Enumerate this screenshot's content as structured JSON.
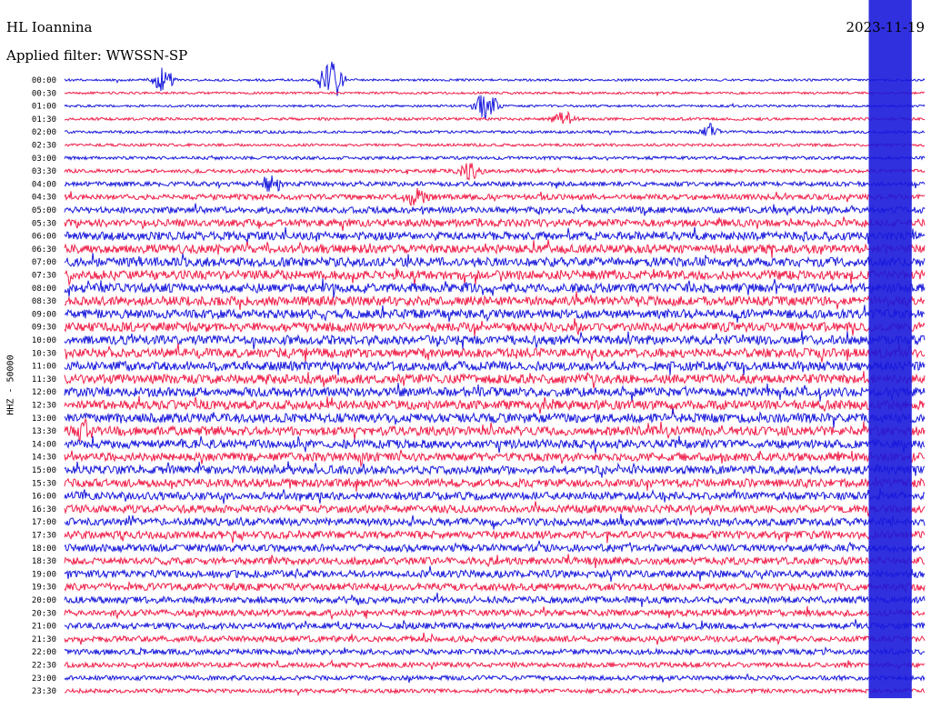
{
  "header": {
    "station": "HL Ioannina",
    "filter": "Applied filter: WWSSN-SP",
    "date": "2023-11-19"
  },
  "channel_label": "HHZ - 50000",
  "colors": {
    "trace_a": "#1a1adc",
    "trace_b": "#f0204a",
    "background": "#ffffff"
  },
  "chart_data": {
    "type": "line",
    "title": "",
    "row_labels": [
      "00:00",
      "00:30",
      "01:00",
      "01:30",
      "02:00",
      "02:30",
      "03:00",
      "03:30",
      "04:00",
      "04:30",
      "05:00",
      "05:30",
      "06:00",
      "06:30",
      "07:00",
      "07:30",
      "08:00",
      "08:30",
      "09:00",
      "09:30",
      "10:00",
      "10:30",
      "11:00",
      "11:30",
      "12:00",
      "12:30",
      "13:00",
      "13:30",
      "14:00",
      "14:30",
      "15:00",
      "15:30",
      "16:00",
      "16:30",
      "17:00",
      "17:30",
      "18:00",
      "18:30",
      "19:00",
      "19:30",
      "20:00",
      "20:30",
      "21:00",
      "21:30",
      "22:00",
      "22:30",
      "23:00",
      "23:30"
    ],
    "row_colors_alternating": [
      "trace_a",
      "trace_b"
    ],
    "noise_level_by_row": [
      0.25,
      0.25,
      0.25,
      0.3,
      0.3,
      0.3,
      0.35,
      0.4,
      0.5,
      0.6,
      0.7,
      0.8,
      0.9,
      0.95,
      1.0,
      1.0,
      1.0,
      1.0,
      1.0,
      1.0,
      1.0,
      1.0,
      1.0,
      1.0,
      1.0,
      1.0,
      1.0,
      1.0,
      0.95,
      0.9,
      0.9,
      0.9,
      0.85,
      0.85,
      0.85,
      0.85,
      0.8,
      0.8,
      0.8,
      0.8,
      0.75,
      0.7,
      0.7,
      0.65,
      0.6,
      0.55,
      0.5,
      0.45
    ],
    "events": [
      {
        "row": "00:00",
        "position": 0.115,
        "amplitude": 2.5
      },
      {
        "row": "00:00",
        "position": 0.31,
        "amplitude": 5.0
      },
      {
        "row": "01:00",
        "position": 0.49,
        "amplitude": 3.0
      },
      {
        "row": "01:30",
        "position": 0.58,
        "amplitude": 1.5
      },
      {
        "row": "02:00",
        "position": 0.75,
        "amplitude": 1.5
      },
      {
        "row": "03:30",
        "position": 0.47,
        "amplitude": 2.0
      },
      {
        "row": "04:00",
        "position": 0.24,
        "amplitude": 2.0
      },
      {
        "row": "04:30",
        "position": 0.41,
        "amplitude": 2.0
      },
      {
        "row": "13:30",
        "position": 0.02,
        "amplitude": 2.0
      }
    ],
    "saturation_window": {
      "start": 0.935,
      "end": 0.985,
      "row_from": "00:00",
      "row_to": "23:30"
    }
  }
}
